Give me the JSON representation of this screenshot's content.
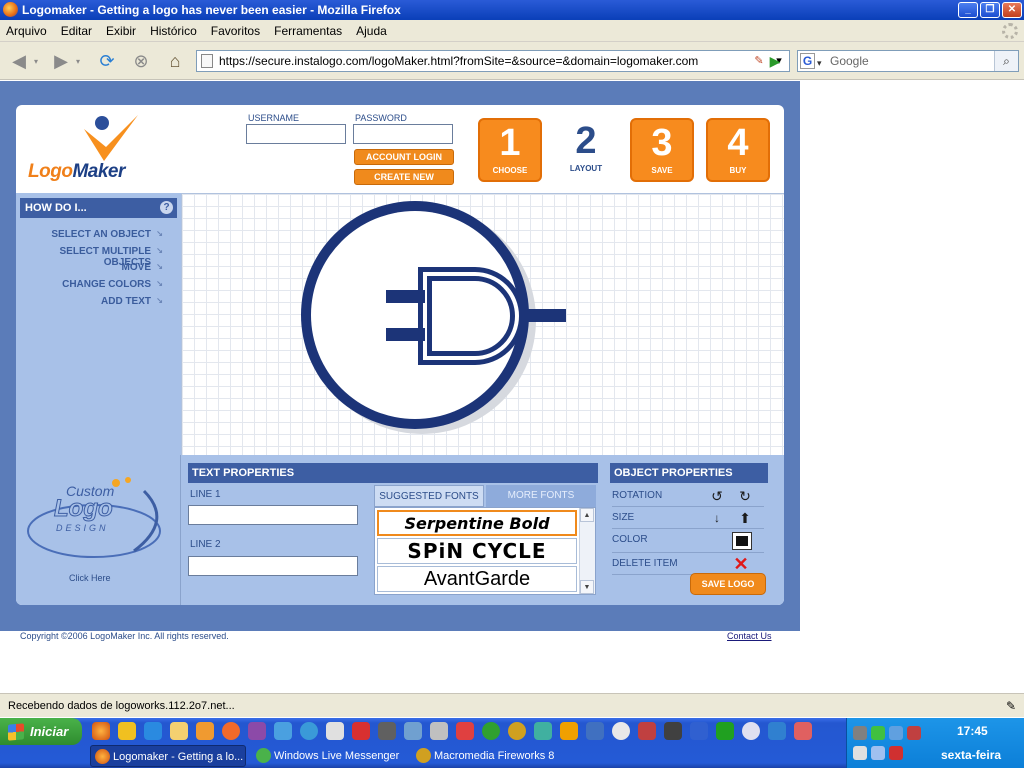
{
  "window": {
    "title": "Logomaker - Getting a logo has never been easier - Mozilla Firefox"
  },
  "menu": [
    "Arquivo",
    "Editar",
    "Exibir",
    "Histórico",
    "Favoritos",
    "Ferramentas",
    "Ajuda"
  ],
  "address": {
    "url": "https://secure.instalogo.com/logoMaker.html?fromSite=&source=&domain=logomaker.com"
  },
  "search": {
    "placeholder": "Google"
  },
  "brand": {
    "logo_part1": "Logo",
    "logo_part2": "Maker"
  },
  "login": {
    "username_label": "USERNAME",
    "password_label": "PASSWORD",
    "account_login": "ACCOUNT LOGIN",
    "create_account": "CREATE NEW ACCOUNT"
  },
  "steps": [
    {
      "num": "1",
      "label": "CHOOSE"
    },
    {
      "num": "2",
      "label": "LAYOUT"
    },
    {
      "num": "3",
      "label": "SAVE"
    },
    {
      "num": "4",
      "label": "BUY"
    }
  ],
  "howdo": {
    "title": "HOW DO I...",
    "help": "?",
    "items": [
      "SELECT AN OBJECT",
      "SELECT MULTIPLE OBJECTS",
      "MOVE",
      "CHANGE COLORS",
      "ADD TEXT"
    ]
  },
  "custom_logo": {
    "line1": "Custom",
    "line2": "Logo",
    "line3": "DESIGN",
    "click": "Click Here"
  },
  "text_props": {
    "title": "TEXT PROPERTIES",
    "line1": "LINE 1",
    "line2": "LINE 2",
    "tab_suggested": "SUGGESTED FONTS",
    "tab_more": "MORE FONTS",
    "fonts": [
      "Serpentine Bold",
      "SPiN CYCLE",
      "AvantGarde"
    ]
  },
  "obj_props": {
    "title": "OBJECT PROPERTIES",
    "rotation": "ROTATION",
    "size": "SIZE",
    "color": "COLOR",
    "delete": "DELETE ITEM",
    "save": "SAVE LOGO"
  },
  "footer": {
    "copyright": "Copyright ©2006 LogoMaker Inc. All rights reserved.",
    "contact": "Contact Us"
  },
  "status": {
    "text": "Recebendo dados de logoworks.112.2o7.net..."
  },
  "taskbar": {
    "start": "Iniciar",
    "tasks": [
      "Logomaker - Getting a lo...",
      "Windows Live Messenger",
      "Macromedia Fireworks 8"
    ],
    "clock": "17:45",
    "day": "sexta-feira"
  },
  "colors": {
    "orange": "#f78b1e",
    "navy": "#1c3478",
    "panel_blue": "#5b7cb9"
  }
}
